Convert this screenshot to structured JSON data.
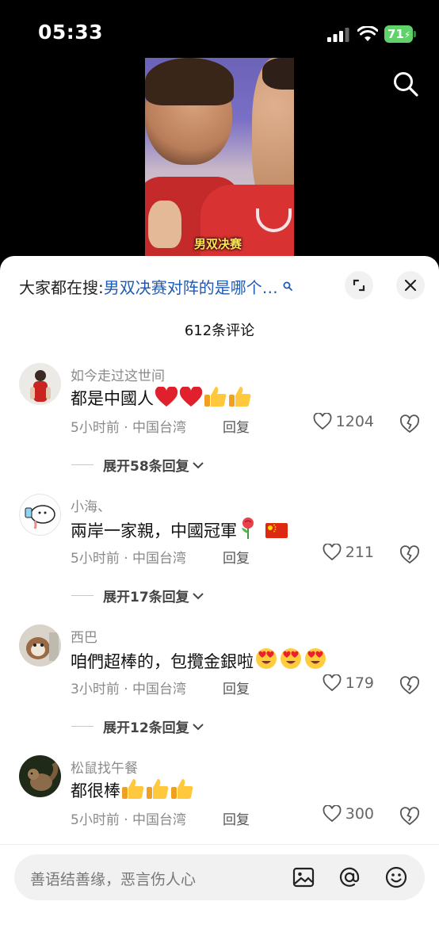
{
  "status": {
    "time": "05:33",
    "battery": "71"
  },
  "video": {
    "caption": "男双决赛"
  },
  "sheet": {
    "suggest_prefix": "大家都在搜:",
    "suggest_query": "男双决赛对阵的是哪个…",
    "comment_count": "612条评论"
  },
  "comments": [
    {
      "name": "如今走过这世间",
      "text": "都是中國人",
      "time": "5小时前 · 中国台湾",
      "reply": "回复",
      "likes": "1204",
      "expand": "展开58条回复",
      "emojis": [
        "red-heart",
        "red-heart",
        "thumbs-up",
        "thumbs-up"
      ]
    },
    {
      "name": "小海、",
      "text": "兩岸一家親，中國冠軍",
      "time": "5小时前 · 中国台湾",
      "reply": "回复",
      "likes": "211",
      "expand": "展开17条回复",
      "emojis": [
        "rose",
        "china-flag"
      ]
    },
    {
      "name": "西巴",
      "text": "咱們超棒的，包攬金銀啦",
      "time": "3小时前 · 中国台湾",
      "reply": "回复",
      "likes": "179",
      "expand": "展开12条回复",
      "emojis": [
        "heart-eyes",
        "heart-eyes",
        "heart-eyes"
      ]
    },
    {
      "name": "松鼠找午餐",
      "text": "都很棒",
      "time": "5小时前 · 中国台湾",
      "reply": "回复",
      "likes": "300",
      "emojis": [
        "thumbs-up",
        "thumbs-up",
        "thumbs-up"
      ]
    }
  ],
  "input": {
    "placeholder": "善语结善缘，恶言伤人心"
  },
  "colors": {
    "link": "#1e5bb3",
    "battery": "#5fd36a",
    "caption": "#ffe44a"
  }
}
